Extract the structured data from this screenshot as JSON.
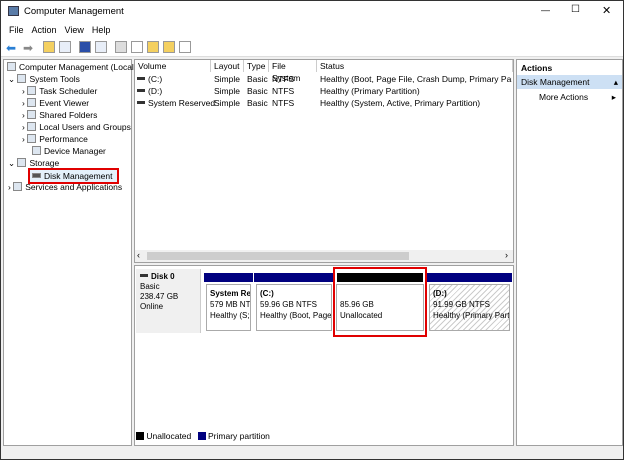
{
  "window": {
    "title": "Computer Management",
    "controls": [
      "—",
      "☐",
      "✕"
    ]
  },
  "menu": [
    "File",
    "Action",
    "View",
    "Help"
  ],
  "tree": {
    "root": "Computer Management (Local",
    "items": [
      {
        "label": "System Tools",
        "level": 1,
        "expanded": true
      },
      {
        "label": "Task Scheduler",
        "level": 2
      },
      {
        "label": "Event Viewer",
        "level": 2
      },
      {
        "label": "Shared Folders",
        "level": 2
      },
      {
        "label": "Local Users and Groups",
        "level": 2
      },
      {
        "label": "Performance",
        "level": 2
      },
      {
        "label": "Device Manager",
        "level": 2
      },
      {
        "label": "Storage",
        "level": 1,
        "expanded": true
      },
      {
        "label": "Disk Management",
        "level": 2,
        "selected": true
      },
      {
        "label": "Services and Applications",
        "level": 1
      }
    ]
  },
  "volumes": {
    "columns": [
      "Volume",
      "Layout",
      "Type",
      "File System",
      "Status"
    ],
    "rows": [
      [
        "(C:)",
        "Simple",
        "Basic",
        "NTFS",
        "Healthy (Boot, Page File, Crash Dump, Primary Partitio"
      ],
      [
        "(D:)",
        "Simple",
        "Basic",
        "NTFS",
        "Healthy (Primary Partition)"
      ],
      [
        "System Reserved",
        "Simple",
        "Basic",
        "NTFS",
        "Healthy (System, Active, Primary Partition)"
      ]
    ]
  },
  "disk": {
    "name": "Disk 0",
    "type": "Basic",
    "size": "238.47 GB",
    "status": "Online",
    "partitions": [
      {
        "title": "System Re",
        "line1": "579 MB NT",
        "line2": "Healthy (S;"
      },
      {
        "title": "(C:)",
        "line1": "59.96 GB NTFS",
        "line2": "Healthy (Boot, Page"
      },
      {
        "title": "",
        "line1": "85.96 GB",
        "line2": "Unallocated"
      },
      {
        "title": "(D:)",
        "line1": "91.99 GB NTFS",
        "line2": "Healthy (Primary Parti"
      }
    ]
  },
  "legend": [
    {
      "label": "Unallocated",
      "color": "#000000"
    },
    {
      "label": "Primary partition",
      "color": "#00007f"
    }
  ],
  "actions": {
    "header": "Actions",
    "section": "Disk Management",
    "more": "More Actions"
  },
  "colors": {
    "highlight": "#e00000",
    "primary": "#00007f"
  }
}
